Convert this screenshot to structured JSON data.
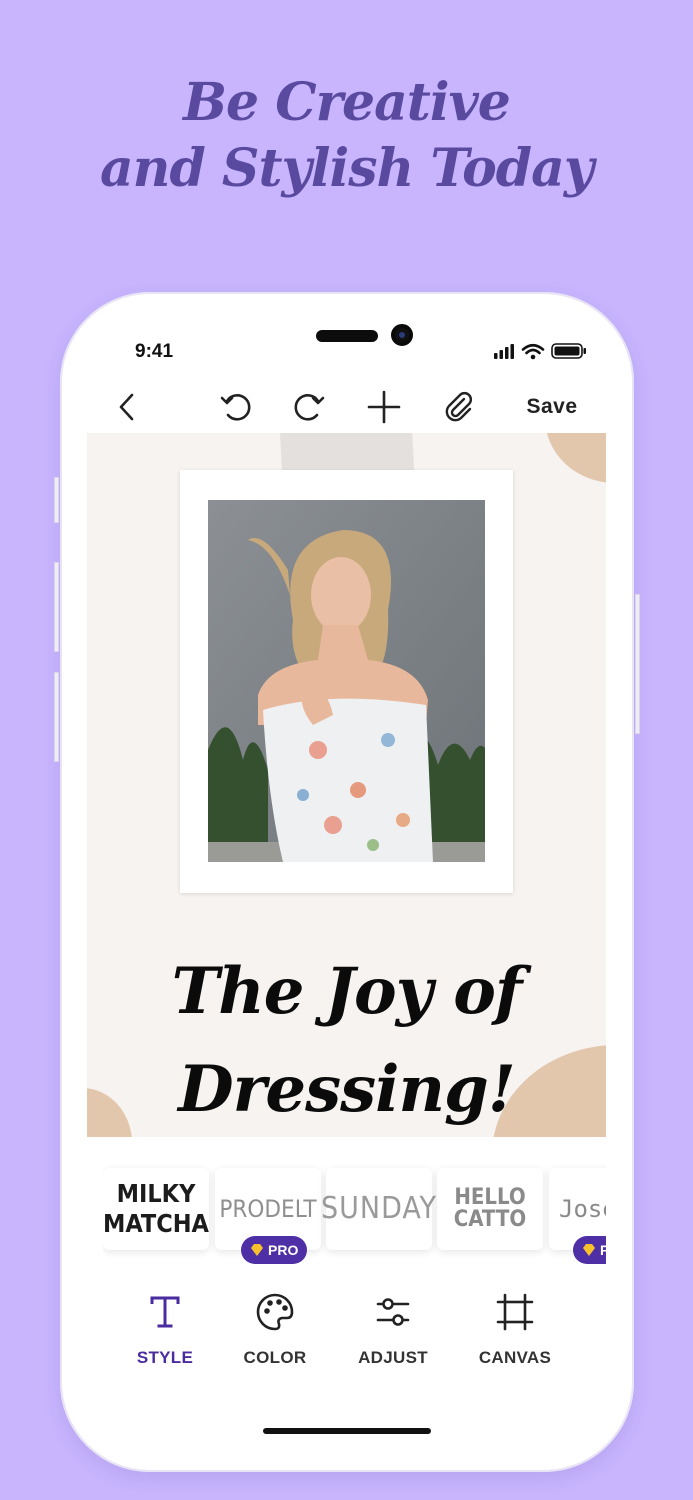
{
  "headline": {
    "line1": "Be Creative",
    "line2": "and Stylish Today"
  },
  "status_bar": {
    "time": "9:41"
  },
  "toolbar": {
    "back_icon": "chevron-left-icon",
    "undo_icon": "undo-icon",
    "redo_icon": "redo-icon",
    "add_icon": "plus-icon",
    "attach_icon": "paperclip-icon",
    "save_label": "Save"
  },
  "canvas": {
    "caption_line1": "The Joy of",
    "caption_line2": "Dressing!"
  },
  "font_styles": [
    {
      "line1": "MILKY",
      "line2": "MATCHA",
      "pro": false,
      "selected": true
    },
    {
      "line1": "PRODELT",
      "line2": "",
      "pro": true,
      "pro_label": "PRO"
    },
    {
      "line1": "SUNDAY",
      "line2": "",
      "pro": false
    },
    {
      "line1": "HELLO",
      "line2": "CATTO",
      "pro": false
    },
    {
      "line1": "Jose",
      "line2": "",
      "pro": true,
      "pro_label": "P"
    }
  ],
  "tabs": [
    {
      "label": "STYLE",
      "icon": "text-icon",
      "active": true
    },
    {
      "label": "COLOR",
      "icon": "palette-icon",
      "active": false
    },
    {
      "label": "ADJUST",
      "icon": "sliders-icon",
      "active": false
    },
    {
      "label": "CANVAS",
      "icon": "crop-icon",
      "active": false
    }
  ],
  "colors": {
    "background": "#c8b5fe",
    "headline": "#5a4a9f",
    "accent": "#4a2ba0",
    "canvas": "#f6f3f1",
    "blob": "#e3c7ad"
  }
}
